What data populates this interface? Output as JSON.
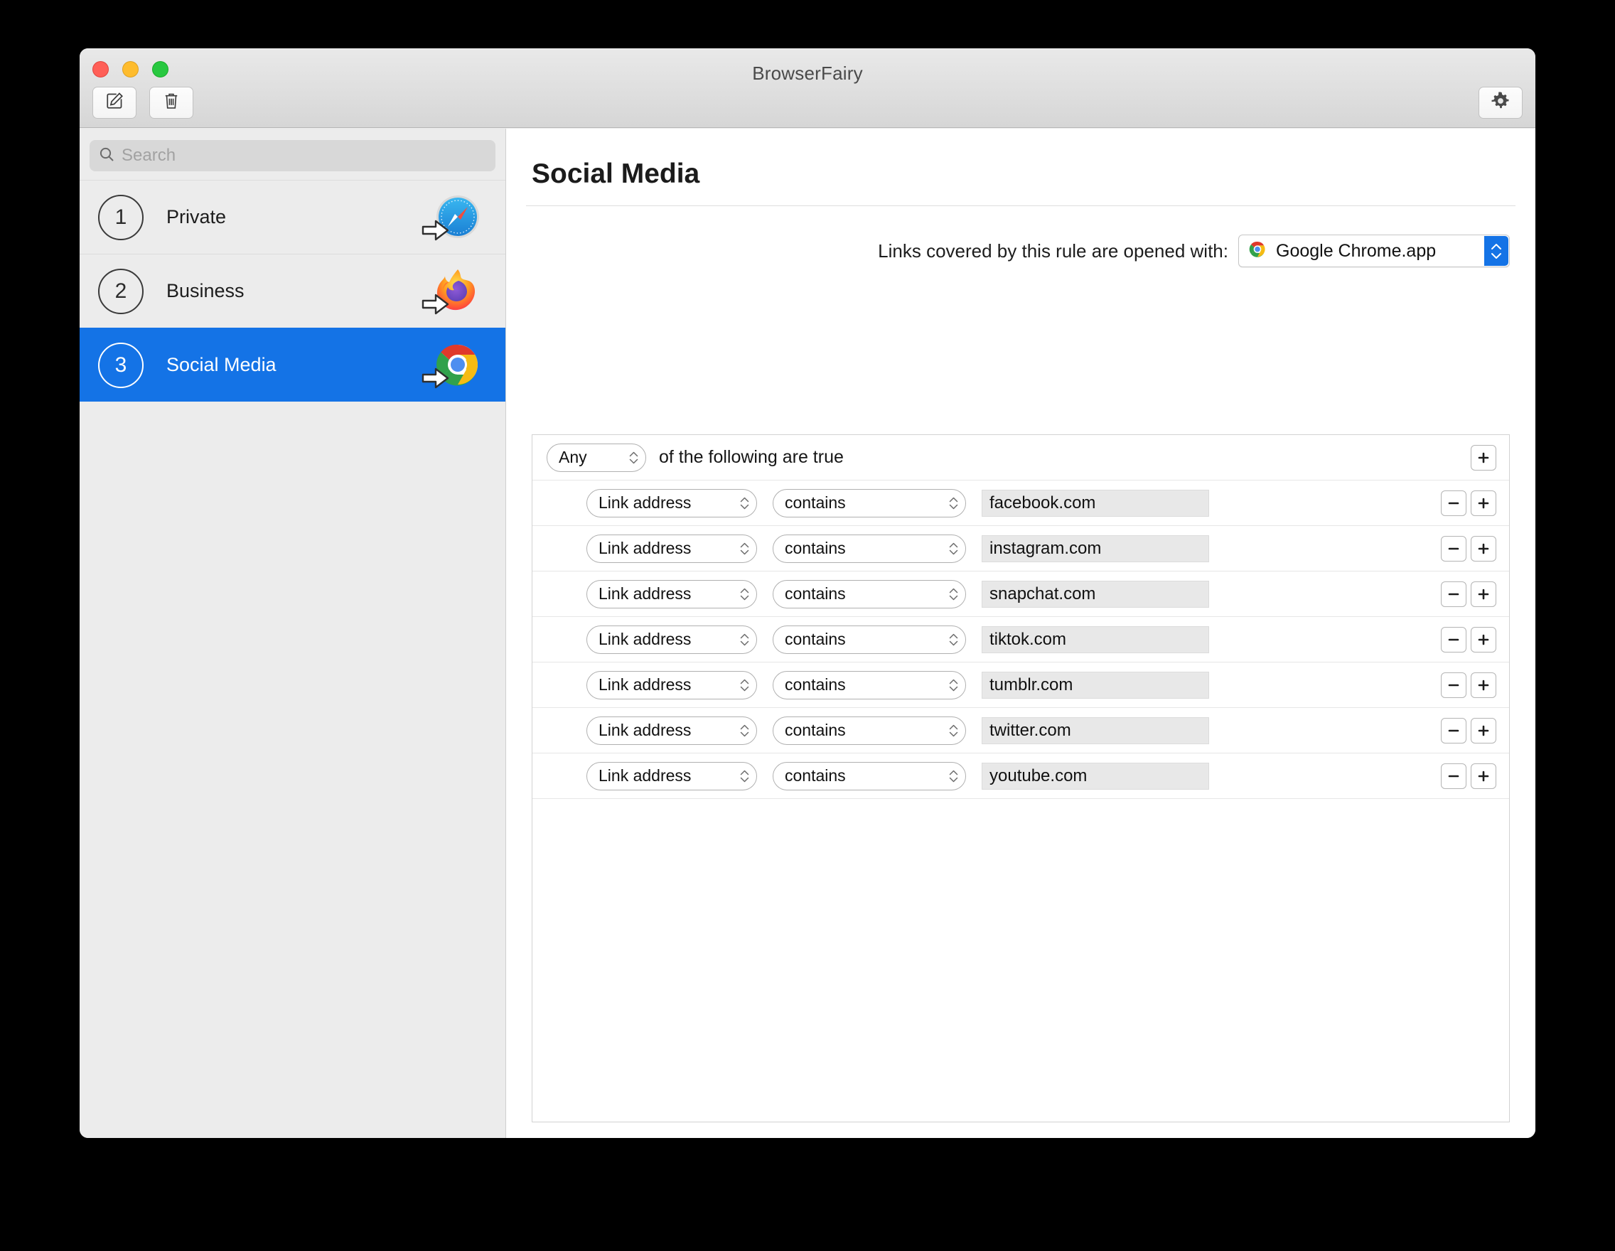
{
  "window": {
    "title": "BrowserFairy",
    "traffic_lights": [
      "close-red",
      "minimize-yellow",
      "maximize-green"
    ],
    "colors": {
      "accent": "#1473e6",
      "close": "#ff5f57",
      "minimize": "#febc2e",
      "maximize": "#28c840"
    }
  },
  "toolbar": {
    "new_rule_icon": "compose-icon",
    "delete_icon": "trash-icon",
    "settings_icon": "gear-icon"
  },
  "sidebar": {
    "search": {
      "placeholder": "Search",
      "value": "",
      "icon": "search-icon"
    },
    "items": [
      {
        "number": "1",
        "label": "Private",
        "browser_icon": "safari-icon",
        "selected": false
      },
      {
        "number": "2",
        "label": "Business",
        "browser_icon": "firefox-icon",
        "selected": false
      },
      {
        "number": "3",
        "label": "Social Media",
        "browser_icon": "chrome-icon",
        "selected": true
      }
    ]
  },
  "main": {
    "title": "Social Media",
    "open_with": {
      "label": "Links covered by this rule are opened with:",
      "selected_browser": "Google Chrome.app",
      "browser_icon": "chrome-icon"
    },
    "match_header": {
      "match_mode": "Any",
      "suffix_text": "of the following are true",
      "add_label": "+"
    },
    "conditions": [
      {
        "field": "Link address",
        "operator": "contains",
        "value": "facebook.com",
        "remove_label": "−",
        "add_label": "+"
      },
      {
        "field": "Link address",
        "operator": "contains",
        "value": "instagram.com",
        "remove_label": "−",
        "add_label": "+"
      },
      {
        "field": "Link address",
        "operator": "contains",
        "value": "snapchat.com",
        "remove_label": "−",
        "add_label": "+"
      },
      {
        "field": "Link address",
        "operator": "contains",
        "value": "tiktok.com",
        "remove_label": "−",
        "add_label": "+"
      },
      {
        "field": "Link address",
        "operator": "contains",
        "value": "tumblr.com",
        "remove_label": "−",
        "add_label": "+"
      },
      {
        "field": "Link address",
        "operator": "contains",
        "value": "twitter.com",
        "remove_label": "−",
        "add_label": "+"
      },
      {
        "field": "Link address",
        "operator": "contains",
        "value": "youtube.com",
        "remove_label": "−",
        "add_label": "+"
      }
    ]
  }
}
